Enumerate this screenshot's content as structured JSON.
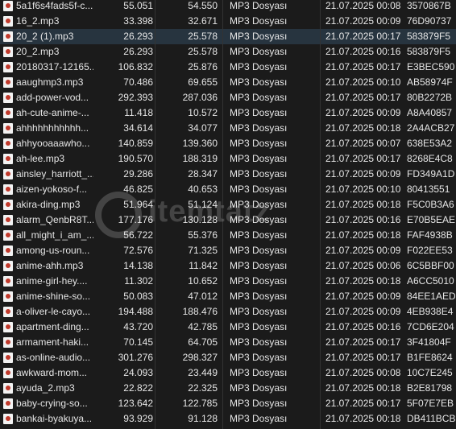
{
  "file_type_label": "MP3 Dosyası",
  "selected_index": 2,
  "watermark": {
    "text": "itemtatz"
  },
  "files": [
    {
      "name": "5a1f6s4fads5f-c...",
      "size": "55.051",
      "packed": "54.550",
      "type": "MP3 Dosyası",
      "modified": "21.07.2025 00:08",
      "crc": "3570867B"
    },
    {
      "name": "16_2.mp3",
      "size": "33.398",
      "packed": "32.671",
      "type": "MP3 Dosyası",
      "modified": "21.07.2025 00:09",
      "crc": "76D90737"
    },
    {
      "name": "20_2 (1).mp3",
      "size": "26.293",
      "packed": "25.578",
      "type": "MP3 Dosyası",
      "modified": "21.07.2025 00:17",
      "crc": "583879F5"
    },
    {
      "name": "20_2.mp3",
      "size": "26.293",
      "packed": "25.578",
      "type": "MP3 Dosyası",
      "modified": "21.07.2025 00:16",
      "crc": "583879F5"
    },
    {
      "name": "20180317-12165...",
      "size": "106.832",
      "packed": "25.876",
      "type": "MP3 Dosyası",
      "modified": "21.07.2025 00:17",
      "crc": "E3BEC590"
    },
    {
      "name": "aaughmp3.mp3",
      "size": "70.486",
      "packed": "69.655",
      "type": "MP3 Dosyası",
      "modified": "21.07.2025 00:10",
      "crc": "AB58974F"
    },
    {
      "name": "add-power-vod...",
      "size": "292.393",
      "packed": "287.036",
      "type": "MP3 Dosyası",
      "modified": "21.07.2025 00:17",
      "crc": "80B2272B"
    },
    {
      "name": "ah-cute-anime-...",
      "size": "11.418",
      "packed": "10.572",
      "type": "MP3 Dosyası",
      "modified": "21.07.2025 00:09",
      "crc": "A8A40857"
    },
    {
      "name": "ahhhhhhhhhhh...",
      "size": "34.614",
      "packed": "34.077",
      "type": "MP3 Dosyası",
      "modified": "21.07.2025 00:18",
      "crc": "2A4ACB27"
    },
    {
      "name": "ahhyooaaawho...",
      "size": "140.859",
      "packed": "139.360",
      "type": "MP3 Dosyası",
      "modified": "21.07.2025 00:07",
      "crc": "638E53A2"
    },
    {
      "name": "ah-lee.mp3",
      "size": "190.570",
      "packed": "188.319",
      "type": "MP3 Dosyası",
      "modified": "21.07.2025 00:17",
      "crc": "8268E4C8"
    },
    {
      "name": "ainsley_harriott_...",
      "size": "29.286",
      "packed": "28.347",
      "type": "MP3 Dosyası",
      "modified": "21.07.2025 00:09",
      "crc": "FD349A1D"
    },
    {
      "name": "aizen-yokoso-f...",
      "size": "46.825",
      "packed": "40.653",
      "type": "MP3 Dosyası",
      "modified": "21.07.2025 00:10",
      "crc": "80413551"
    },
    {
      "name": "akira-ding.mp3",
      "size": "51.964",
      "packed": "51.124",
      "type": "MP3 Dosyası",
      "modified": "21.07.2025 00:18",
      "crc": "F5C0B3A6"
    },
    {
      "name": "alarm_QenbR8T...",
      "size": "177.176",
      "packed": "130.128",
      "type": "MP3 Dosyası",
      "modified": "21.07.2025 00:16",
      "crc": "E70B5EAE"
    },
    {
      "name": "all_might_i_am_...",
      "size": "56.722",
      "packed": "55.376",
      "type": "MP3 Dosyası",
      "modified": "21.07.2025 00:18",
      "crc": "FAF4938B"
    },
    {
      "name": "among-us-roun...",
      "size": "72.576",
      "packed": "71.325",
      "type": "MP3 Dosyası",
      "modified": "21.07.2025 00:09",
      "crc": "F022EE53"
    },
    {
      "name": "anime-ahh.mp3",
      "size": "14.138",
      "packed": "11.842",
      "type": "MP3 Dosyası",
      "modified": "21.07.2025 00:06",
      "crc": "6C5BBF00"
    },
    {
      "name": "anime-girl-hey....",
      "size": "11.302",
      "packed": "10.652",
      "type": "MP3 Dosyası",
      "modified": "21.07.2025 00:18",
      "crc": "A6CC5010"
    },
    {
      "name": "anime-shine-so...",
      "size": "50.083",
      "packed": "47.012",
      "type": "MP3 Dosyası",
      "modified": "21.07.2025 00:09",
      "crc": "84EE1AED"
    },
    {
      "name": "a-oliver-le-cayo...",
      "size": "194.488",
      "packed": "188.476",
      "type": "MP3 Dosyası",
      "modified": "21.07.2025 00:09",
      "crc": "4EB938E4"
    },
    {
      "name": "apartment-ding...",
      "size": "43.720",
      "packed": "42.785",
      "type": "MP3 Dosyası",
      "modified": "21.07.2025 00:16",
      "crc": "7CD6E204"
    },
    {
      "name": "armament-haki...",
      "size": "70.145",
      "packed": "64.705",
      "type": "MP3 Dosyası",
      "modified": "21.07.2025 00:17",
      "crc": "3F41804F"
    },
    {
      "name": "as-online-audio...",
      "size": "301.276",
      "packed": "298.327",
      "type": "MP3 Dosyası",
      "modified": "21.07.2025 00:17",
      "crc": "B1FE8624"
    },
    {
      "name": "awkward-mom...",
      "size": "24.093",
      "packed": "23.449",
      "type": "MP3 Dosyası",
      "modified": "21.07.2025 00:08",
      "crc": "10C7E245"
    },
    {
      "name": "ayuda_2.mp3",
      "size": "22.822",
      "packed": "22.325",
      "type": "MP3 Dosyası",
      "modified": "21.07.2025 00:18",
      "crc": "B2E81798"
    },
    {
      "name": "baby-crying-so...",
      "size": "123.642",
      "packed": "122.785",
      "type": "MP3 Dosyası",
      "modified": "21.07.2025 00:17",
      "crc": "5F07E7EB"
    },
    {
      "name": "bankai-byakuya...",
      "size": "93.929",
      "packed": "91.128",
      "type": "MP3 Dosyası",
      "modified": "21.07.2025 00:18",
      "crc": "DB411BCB"
    }
  ]
}
